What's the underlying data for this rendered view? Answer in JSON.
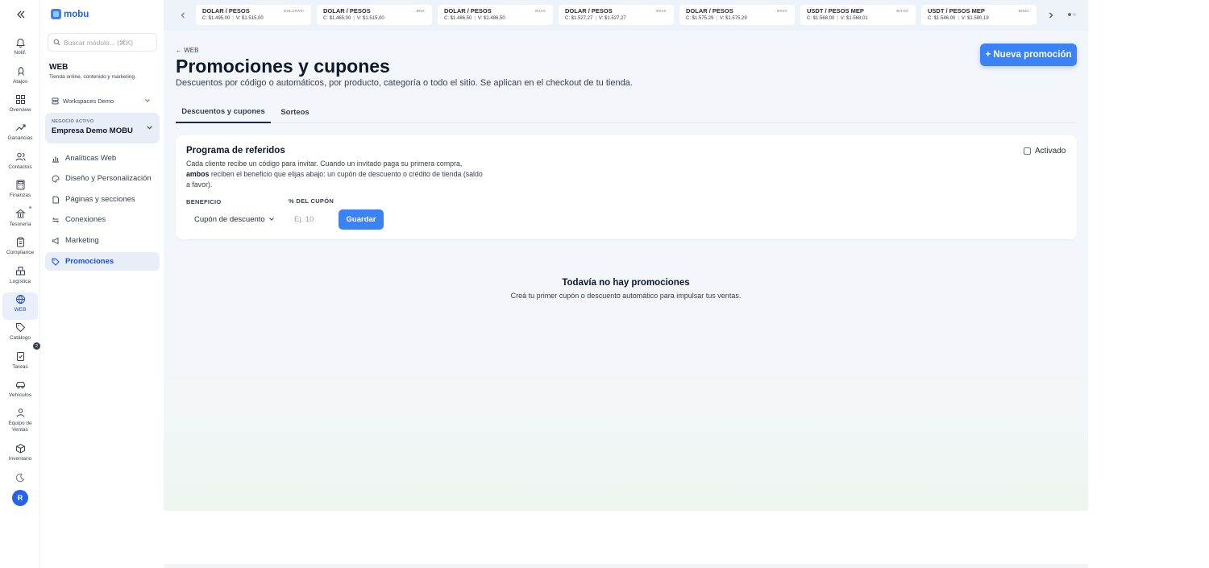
{
  "rail": {
    "items": [
      {
        "label": "Notif.",
        "icon": "bell-icon"
      },
      {
        "label": "Atajos",
        "icon": "rocket-icon"
      },
      {
        "label": "Overview",
        "icon": "grid-icon"
      },
      {
        "label": "Ganancias",
        "icon": "trend-up-icon"
      },
      {
        "label": "Contactos",
        "icon": "users-icon"
      },
      {
        "label": "Finanzas",
        "icon": "calculator-icon"
      },
      {
        "label": "Tesorería",
        "icon": "bank-icon"
      },
      {
        "label": "Compliance",
        "icon": "clipboard-icon"
      },
      {
        "label": "Logística",
        "icon": "boxes-icon"
      },
      {
        "label": "WEB",
        "icon": "globe-icon"
      },
      {
        "label": "Catálogo",
        "icon": "tag-icon"
      },
      {
        "label": "Tareas",
        "icon": "task-icon"
      },
      {
        "label": "Vehículos",
        "icon": "car-icon"
      },
      {
        "label": "Equipo de Ventas",
        "icon": "team-icon"
      },
      {
        "label": "Inventario",
        "icon": "cube-icon"
      }
    ],
    "tasks_badge": "2",
    "avatar_initial": "R"
  },
  "sidebar": {
    "logo_text": "mobu",
    "search_placeholder": "Buscar módulo... (⌘K)",
    "section_title": "WEB",
    "section_subtitle": "Tienda online, contenido y marketing.",
    "workspace": "Workspaces Demo",
    "negocio_label": "NEGOCIO ACTIVO",
    "negocio_name": "Empresa Demo MOBU",
    "nav": [
      {
        "label": "Analíticas Web",
        "icon": "bar-chart-icon"
      },
      {
        "label": "Diseño y Personalización",
        "icon": "palette-icon"
      },
      {
        "label": "Páginas y secciones",
        "icon": "page-icon"
      },
      {
        "label": "Conexiones",
        "icon": "link-icon"
      },
      {
        "label": "Marketing",
        "icon": "megaphone-icon"
      },
      {
        "label": "Promociones",
        "icon": "tag-icon"
      }
    ]
  },
  "ticker": [
    {
      "pair": "DOLAR / PESOS",
      "source": "DOLARAPI",
      "c": "C: $1.495,00",
      "v": "V: $1.515,00"
    },
    {
      "pair": "DOLAR / PESOS",
      "source": "BNA",
      "c": "C: $1.465,00",
      "v": "V: $1.515,00"
    },
    {
      "pair": "DOLAR / PESOS",
      "source": "BAVA",
      "c": "C: $1.486,50",
      "v": "V: $1.486,50"
    },
    {
      "pair": "DOLAR / PESOS",
      "source": "BAVA",
      "c": "C: $1.527,27",
      "v": "V: $1.527,27"
    },
    {
      "pair": "DOLAR / PESOS",
      "source": "BAVA",
      "c": "C: $1.575,29",
      "v": "V: $1.575,29"
    },
    {
      "pair": "USDT / PESOS MEP",
      "source": "BITSO",
      "c": "C: $1.568,00",
      "v": "V: $1.568,01"
    },
    {
      "pair": "USDT / PESOS MEP",
      "source": "BINIO",
      "c": "C: $1.546,00",
      "v": "V: $1.580,19"
    }
  ],
  "main": {
    "back_link": "← WEB",
    "title": "Promociones y cupones",
    "description": "Descuentos por código o automáticos, por producto, categoría o todo el sitio. Se aplican en el checkout de tu tienda.",
    "new_button": "+ Nueva promoción",
    "tabs": [
      {
        "label": "Descuentos y cupones",
        "active": true
      },
      {
        "label": "Sorteos",
        "active": false
      }
    ],
    "referral": {
      "title": "Programa de referidos",
      "desc_1": "Cada cliente recibe un código para invitar. Cuando un invitado paga su primera compra,",
      "desc_bold": "ambos",
      "desc_2": "reciben el beneficio que elijas abajo: un cupón de descuento o crédito de tienda (saldo a favor).",
      "enabled_label": "Activado",
      "enabled": false,
      "benefit_label": "BENEFICIO",
      "benefit_value": "Cupón de descuento",
      "pct_label": "% DEL CUPÓN",
      "pct_placeholder": "Ej. 10",
      "save_button": "Guardar"
    },
    "empty_title": "Todavía no hay promociones",
    "empty_subtitle": "Creá tu primer cupón o descuento automático para impulsar tus ventas."
  },
  "colors": {
    "accent": "#3b82f6",
    "active_bg": "#e8eef8"
  }
}
